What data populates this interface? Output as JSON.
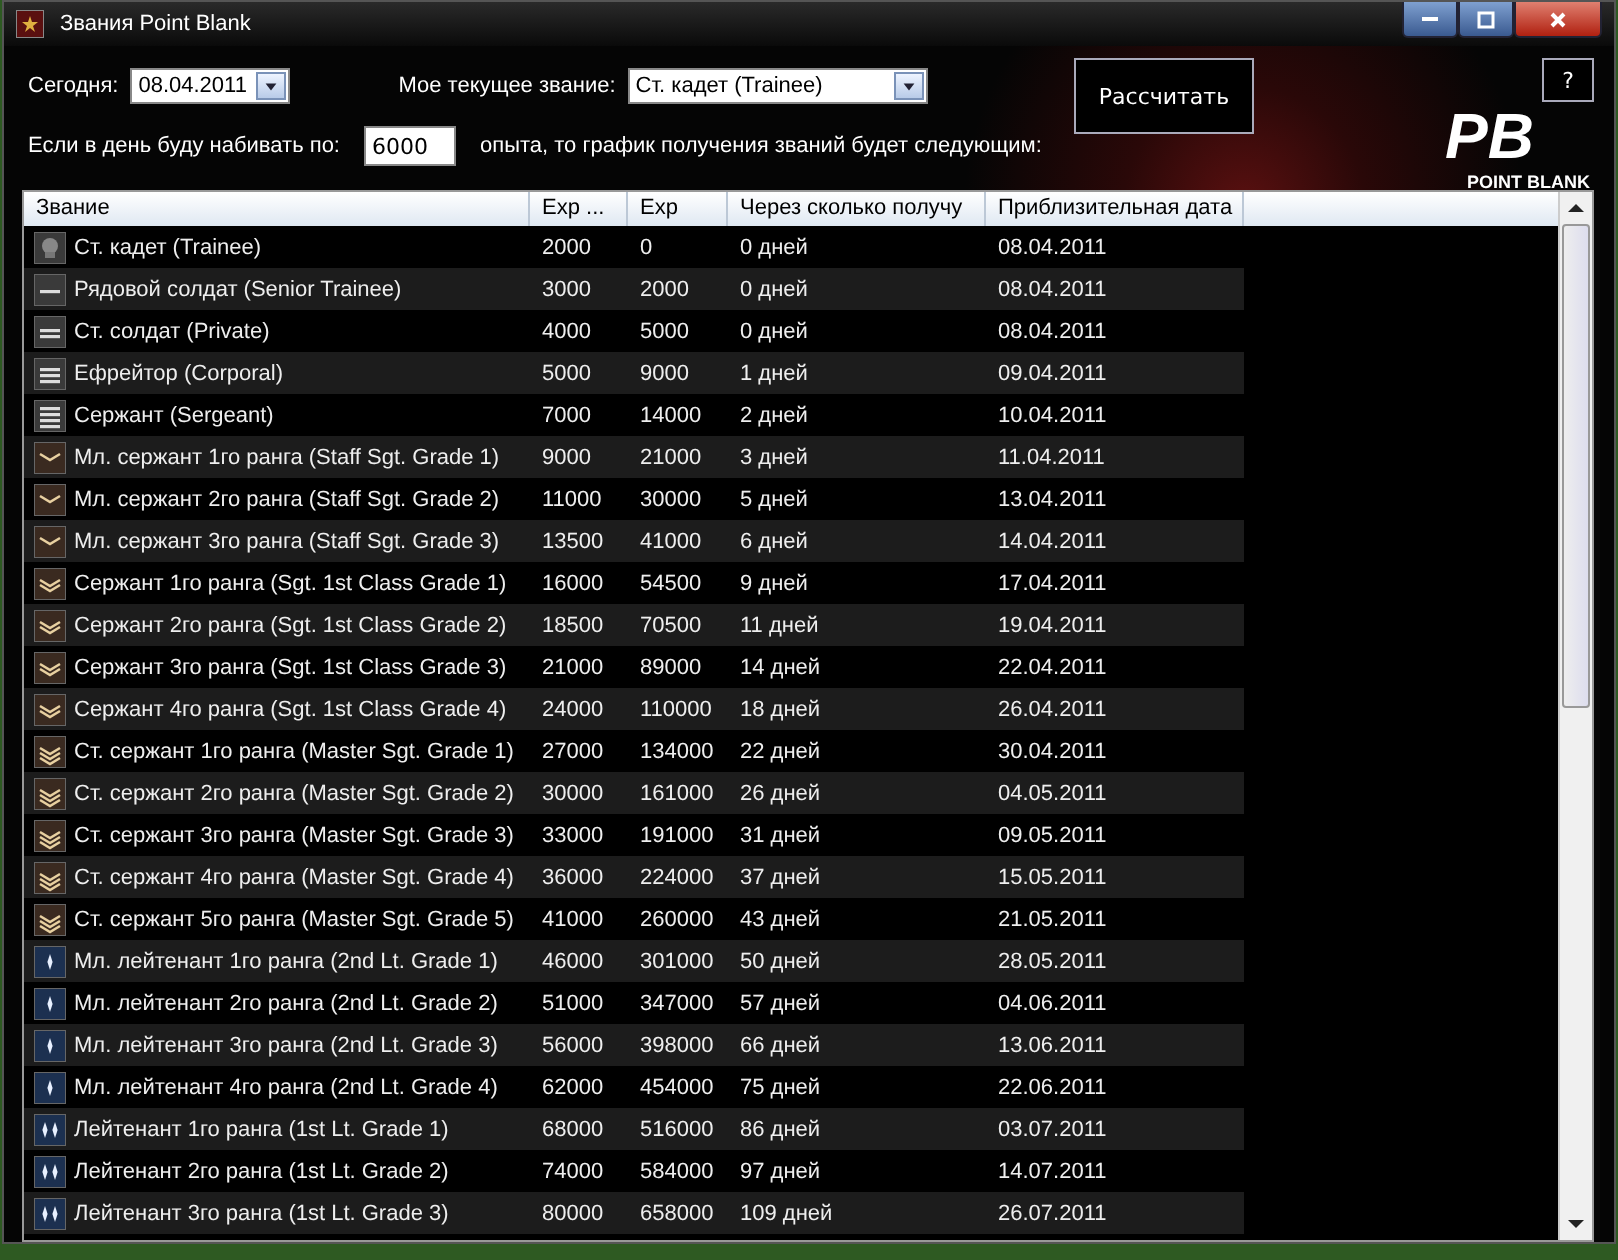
{
  "window": {
    "title": "Звания Point Blank"
  },
  "controls": {
    "today_label": "Сегодня:",
    "today_value": "08.04.2011",
    "rank_label": "Мое текущее звание:",
    "rank_value": "Ст. кадет (Trainee)",
    "daily_label": "Если в день  буду набивать по:",
    "daily_value": "6000",
    "daily_suffix": "опыта, то график получения званий будет следующим:",
    "calculate_button": "Рассчитать",
    "help_button": "?"
  },
  "logo": {
    "mark": "PB",
    "name": "POINT BLANK"
  },
  "table": {
    "columns": [
      "Звание",
      "Exp ...",
      "Exp",
      "Через сколько получу",
      "Приблизительная дата"
    ],
    "rows": [
      {
        "kind": "cadet",
        "cells": [
          "Ст. кадет (Trainee)",
          "2000",
          "0",
          "0 дней",
          "08.04.2011"
        ]
      },
      {
        "kind": "bar1",
        "cells": [
          "Рядовой солдат (Senior Trainee)",
          "3000",
          "2000",
          "0 дней",
          "08.04.2011"
        ]
      },
      {
        "kind": "bar2",
        "cells": [
          "Ст. солдат (Private)",
          "4000",
          "5000",
          "0 дней",
          "08.04.2011"
        ]
      },
      {
        "kind": "bar3",
        "cells": [
          "Ефрейтор (Corporal)",
          "5000",
          "9000",
          "1 дней",
          "09.04.2011"
        ]
      },
      {
        "kind": "bar4",
        "cells": [
          "Сержант (Sergeant)",
          "7000",
          "14000",
          "2 дней",
          "10.04.2011"
        ]
      },
      {
        "kind": "chev1",
        "cells": [
          "Мл. сержант 1го ранга (Staff Sgt. Grade 1)",
          "9000",
          "21000",
          "3 дней",
          "11.04.2011"
        ]
      },
      {
        "kind": "chev1",
        "cells": [
          "Мл. сержант 2го ранга (Staff Sgt. Grade 2)",
          "11000",
          "30000",
          "5 дней",
          "13.04.2011"
        ]
      },
      {
        "kind": "chev1",
        "cells": [
          "Мл. сержант 3го ранга (Staff Sgt. Grade 3)",
          "13500",
          "41000",
          "6 дней",
          "14.04.2011"
        ]
      },
      {
        "kind": "chev2",
        "cells": [
          "Сержант 1го ранга (Sgt. 1st Class Grade 1)",
          "16000",
          "54500",
          "9 дней",
          "17.04.2011"
        ]
      },
      {
        "kind": "chev2",
        "cells": [
          "Сержант 2го ранга (Sgt. 1st Class Grade 2)",
          "18500",
          "70500",
          "11 дней",
          "19.04.2011"
        ]
      },
      {
        "kind": "chev2",
        "cells": [
          "Сержант 3го ранга (Sgt. 1st Class Grade 3)",
          "21000",
          "89000",
          "14 дней",
          "22.04.2011"
        ]
      },
      {
        "kind": "chev2",
        "cells": [
          "Сержант 4го ранга (Sgt. 1st Class Grade 4)",
          "24000",
          "110000",
          "18 дней",
          "26.04.2011"
        ]
      },
      {
        "kind": "chev3",
        "cells": [
          "Ст. сержант 1го ранга (Master Sgt. Grade 1)",
          "27000",
          "134000",
          "22 дней",
          "30.04.2011"
        ]
      },
      {
        "kind": "chev3",
        "cells": [
          "Ст. сержант 2го ранга (Master Sgt. Grade 2)",
          "30000",
          "161000",
          "26 дней",
          "04.05.2011"
        ]
      },
      {
        "kind": "chev3",
        "cells": [
          "Ст. сержант 3го ранга (Master Sgt. Grade 3)",
          "33000",
          "191000",
          "31 дней",
          "09.05.2011"
        ]
      },
      {
        "kind": "chev3",
        "cells": [
          "Ст. сержант 4го ранга (Master Sgt. Grade 4)",
          "36000",
          "224000",
          "37 дней",
          "15.05.2011"
        ]
      },
      {
        "kind": "chev3",
        "cells": [
          "Ст. сержант 5го ранга (Master Sgt. Grade 5)",
          "41000",
          "260000",
          "43 дней",
          "21.05.2011"
        ]
      },
      {
        "kind": "star1",
        "cells": [
          "Мл. лейтенант 1го ранга (2nd Lt. Grade 1)",
          "46000",
          "301000",
          "50 дней",
          "28.05.2011"
        ]
      },
      {
        "kind": "star1",
        "cells": [
          "Мл. лейтенант 2го ранга (2nd Lt. Grade 2)",
          "51000",
          "347000",
          "57 дней",
          "04.06.2011"
        ]
      },
      {
        "kind": "star1",
        "cells": [
          "Мл. лейтенант 3го ранга (2nd Lt. Grade 3)",
          "56000",
          "398000",
          "66 дней",
          "13.06.2011"
        ]
      },
      {
        "kind": "star1",
        "cells": [
          "Мл. лейтенант 4го ранга (2nd Lt. Grade 4)",
          "62000",
          "454000",
          "75 дней",
          "22.06.2011"
        ]
      },
      {
        "kind": "star2",
        "cells": [
          "Лейтенант 1го ранга (1st Lt. Grade 1)",
          "68000",
          "516000",
          "86 дней",
          "03.07.2011"
        ]
      },
      {
        "kind": "star2",
        "cells": [
          "Лейтенант 2го ранга (1st Lt. Grade 2)",
          "74000",
          "584000",
          "97 дней",
          "14.07.2011"
        ]
      },
      {
        "kind": "star2",
        "cells": [
          "Лейтенант 3го ранга (1st Lt. Grade 3)",
          "80000",
          "658000",
          "109 дней",
          "26.07.2011"
        ]
      }
    ]
  }
}
